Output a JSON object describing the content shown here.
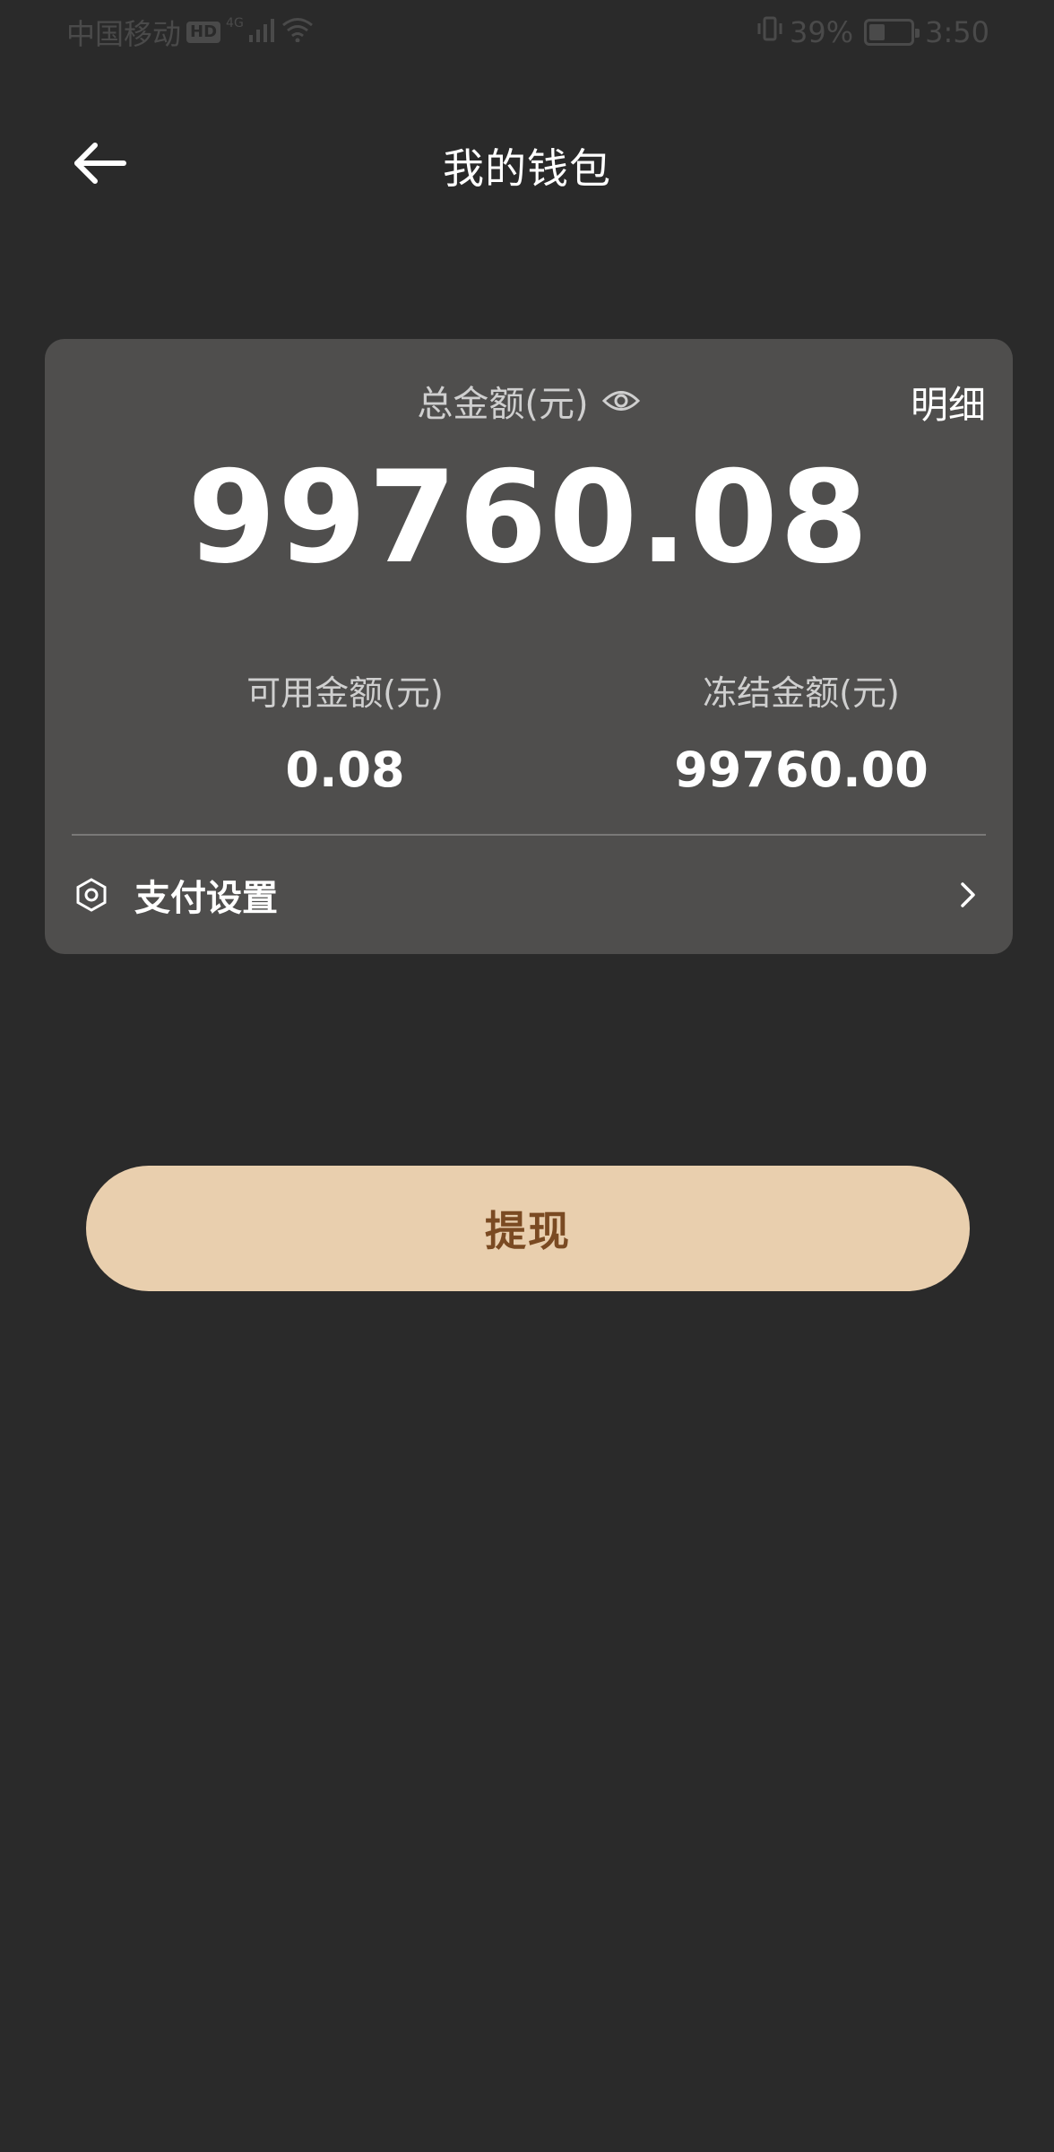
{
  "status_bar": {
    "carrier": "中国移动",
    "hd_badge": "HD",
    "network": "4G",
    "battery_percent": "39%",
    "battery_level": 0.39,
    "time": "3:50"
  },
  "header": {
    "title": "我的钱包"
  },
  "wallet": {
    "total_label": "总金额(元)",
    "detail_label": "明细",
    "total_amount": "99760.08",
    "available_label": "可用金额(元)",
    "available_amount": "0.08",
    "frozen_label": "冻结金额(元)",
    "frozen_amount": "99760.00",
    "pay_settings_label": "支付设置"
  },
  "actions": {
    "withdraw_label": "提现"
  },
  "colors": {
    "background": "#2a2a2a",
    "card": "#4f4e4d",
    "withdraw_button": "#e9cfae",
    "withdraw_text": "#7a4a22"
  },
  "icons": {
    "back": "arrow-left-icon",
    "visibility": "eye-icon",
    "settings": "hexagon-settings-icon",
    "chevron": "chevron-right-icon"
  }
}
